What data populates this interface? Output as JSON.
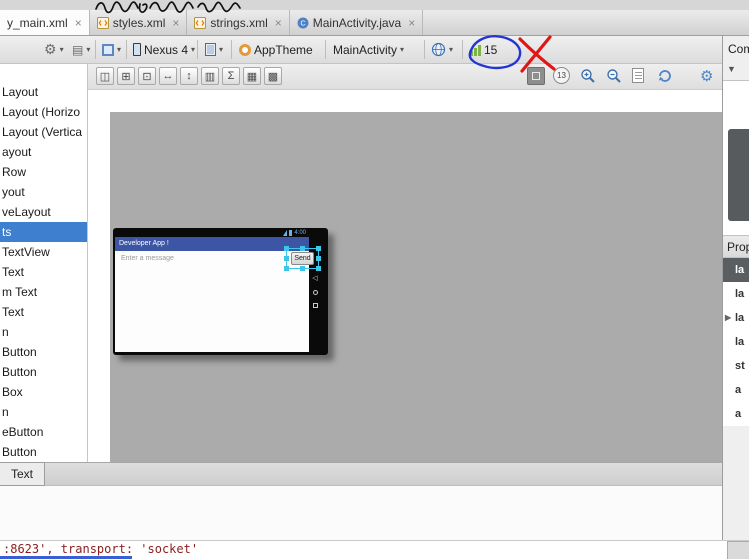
{
  "window": {
    "handwriting_annotation": "activity_mainxml"
  },
  "icons": {
    "caret": "▾",
    "gear": "⚙",
    "close": "×",
    "expand": "▶",
    "dropdown": "▼",
    "back_nav": "◁",
    "panel": "▤",
    "class_letter": "C",
    "t2": [
      "◫",
      "⊞",
      "⊡",
      "↔",
      "↕",
      "▥",
      "Σ",
      "▦",
      "▩"
    ]
  },
  "tabs": [
    {
      "label": "y_main.xml"
    },
    {
      "label": "styles.xml"
    },
    {
      "label": "strings.xml"
    },
    {
      "label": "MainActivity.java"
    }
  ],
  "config_toolbar": {
    "device": "Nexus 4",
    "theme": "AppTheme",
    "activity": "MainActivity",
    "api_level": "15"
  },
  "design_toolbar": {
    "zoom_badge": "13"
  },
  "palette": {
    "items": [
      "Layout",
      "Layout (Horizo",
      "Layout (Vertica",
      "ayout",
      "Row",
      "yout",
      "veLayout",
      "ts",
      "TextView",
      "Text",
      "m Text",
      "Text",
      "n",
      "Button",
      "Button",
      "Box",
      "n",
      "eButton",
      "Button"
    ],
    "selected_index": 7
  },
  "canvas": {
    "status_time": "4:00",
    "app_title": "Developer App !",
    "edittext_hint": "Enter a message",
    "send_label": "Send"
  },
  "right_panel": {
    "component_tree_title": "Com",
    "properties_title": "Prop",
    "property_rows": [
      "la",
      "la",
      "la",
      "la",
      "st",
      "a",
      "a"
    ]
  },
  "bottom": {
    "mode_tab": "Text",
    "console_text": ":8623', transport: 'socket'"
  }
}
